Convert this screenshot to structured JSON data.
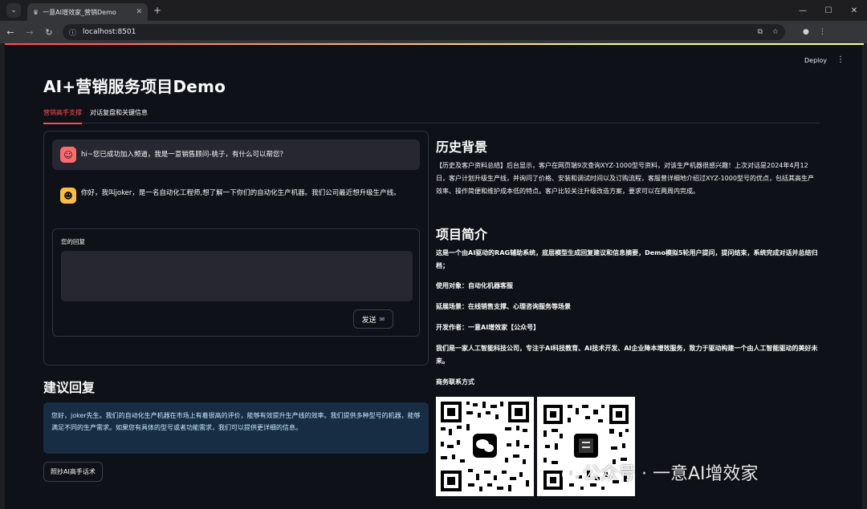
{
  "browser": {
    "tab_title": "一意AI增效家_营销Demo",
    "url": "localhost:8501"
  },
  "header": {
    "deploy_label": "Deploy"
  },
  "page": {
    "title": "AI+营销服务项目Demo"
  },
  "tabs": [
    {
      "label": "营销高手支撑",
      "active": true
    },
    {
      "label": "对话复盘和关键信息",
      "active": false
    }
  ],
  "chat": {
    "messages": [
      {
        "role": "assistant",
        "text": "hi~您已成功加入频道，我是一意销售顾问-桃子，有什么可以帮您？"
      },
      {
        "role": "user",
        "text": "你好，我叫joker，是一名自动化工程师,想了解一下你们的自动化生产机器。我们公司最近想升级生产线。"
      }
    ],
    "form": {
      "label": "您的回复",
      "value": "",
      "send_label": "发送",
      "send_icon": "envelope-icon"
    }
  },
  "suggestion": {
    "heading": "建议回复",
    "text": "您好，joker先生。我们的自动化生产机器在市场上有着很高的评价，能够有效提升生产线的效率。我们提供多种型号的机器，能够满足不同的生产需求。如果您有具体的型号或者功能需求，我们可以提供更详细的信息。",
    "copy_label": "照抄AI高手话术"
  },
  "history": {
    "heading": "历史背景",
    "text": "【历史及客户资料总结】后台显示，客户在网页端9次查询XYZ-1000型号资料，对该生产机器很感兴趣！上次对话是2024年4月12日，客户计划升级生产线，并询问了价格、安装和调试时间以及订购流程，客服曾详细地介绍过XYZ-1000型号的优点，包括其高生产效率、操作简便和维护成本低的特点。客户比较关注升级改造方案，要求可以在两周内完成。"
  },
  "project": {
    "heading": "项目简介",
    "intro": "这是一个由AI驱动的RAG辅助系统，底层模型生成回复建议和信息摘要，Demo模拟5轮用户提问，提问结束，系统完成对话并总结归档；",
    "target": "使用对象：自动化机器客服",
    "scenario": "延展场景：在线销售支撑、心理咨询服务等场景",
    "author": "开发作者：一意AI增效家【公众号】",
    "company": "我们是一家人工智能科技公司，专注于AI科技教育、AI技术开发、AI企业降本增效服务，致力于驱动构建一个由人工智能驱动的美好未来。",
    "contact_label": "商务联系方式"
  },
  "watermark": "公众号 · 一意AI增效家",
  "colors": {
    "accent": "#ff4b4b",
    "app_bg": "#0e1117",
    "info_bg": "#172d43"
  }
}
